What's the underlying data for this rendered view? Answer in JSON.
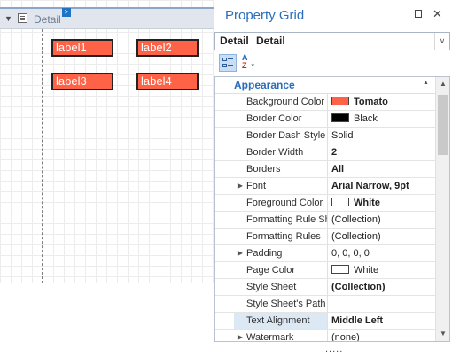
{
  "designer": {
    "band_title": "Detail",
    "band_toggle_glyph": "▼",
    "smart_tag_glyph": ">",
    "label_color": "#ff6347",
    "labels": [
      "label1",
      "label2",
      "label3",
      "label4"
    ]
  },
  "panel": {
    "title": "Property Grid",
    "pin_icon": "pin-icon",
    "close_glyph": "✕",
    "selector": {
      "name": "Detail",
      "type": "Detail",
      "arrow_glyph": "∨"
    },
    "toolbar": {
      "categorized_icon": "categorized-icon",
      "alphabetical_icon": "sort-alphabetical-icon",
      "alpha_a": "A",
      "alpha_z": "Z",
      "alpha_arrow": "↓"
    },
    "category": {
      "label": "Appearance",
      "collapse_glyph": "▲"
    },
    "properties": [
      {
        "name": "Background Color",
        "value": "Tomato",
        "swatch": "#ff6347",
        "bold": true
      },
      {
        "name": "Border Color",
        "value": "Black",
        "swatch": "#000000",
        "bold": false
      },
      {
        "name": "Border Dash Style",
        "value": "Solid",
        "bold": false
      },
      {
        "name": "Border Width",
        "value": "2",
        "bold": true
      },
      {
        "name": "Borders",
        "value": "All",
        "bold": true
      },
      {
        "name": "Font",
        "value": "Arial Narrow, 9pt",
        "bold": true,
        "expandable": true
      },
      {
        "name": "Foreground Color",
        "value": "White",
        "swatch": "#ffffff",
        "bold": true
      },
      {
        "name": "Formatting Rule Sh",
        "value": "(Collection)",
        "bold": false
      },
      {
        "name": "Formatting Rules",
        "value": "(Collection)",
        "bold": false
      },
      {
        "name": "Padding",
        "value": "0, 0, 0, 0",
        "bold": false,
        "expandable": true
      },
      {
        "name": "Page Color",
        "value": "White",
        "swatch": "#ffffff",
        "bold": false
      },
      {
        "name": "Style Sheet",
        "value": "(Collection)",
        "bold": true
      },
      {
        "name": "Style Sheet's Path",
        "value": "",
        "bold": false
      },
      {
        "name": "Text Alignment",
        "value": "Middle Left",
        "bold": true,
        "selected": true
      },
      {
        "name": "Watermark",
        "value": "(none)",
        "bold": false,
        "expandable": true
      }
    ],
    "expand_glyph": "▶",
    "scroll_up_glyph": "▲",
    "scroll_down_glyph": "▼",
    "grip_glyph": "....."
  }
}
